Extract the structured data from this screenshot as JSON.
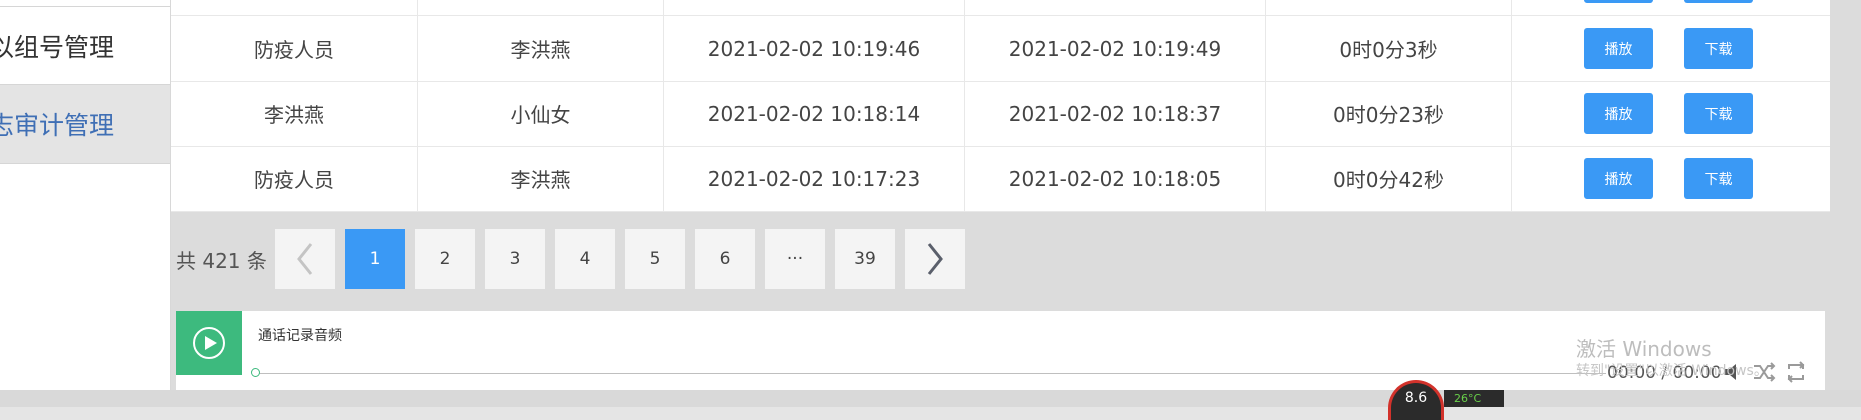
{
  "sidebar": {
    "items": [
      {
        "label": "以组号管理"
      },
      {
        "label": "志审计管理"
      }
    ]
  },
  "table": {
    "rows": [
      {
        "caller": "",
        "callee": "",
        "start": "",
        "end": "",
        "duration": ""
      },
      {
        "caller": "防疫人员",
        "callee": "李洪燕",
        "start": "2021-02-02 10:19:46",
        "end": "2021-02-02 10:19:49",
        "duration": "0时0分3秒"
      },
      {
        "caller": "李洪燕",
        "callee": "小仙女",
        "start": "2021-02-02 10:18:14",
        "end": "2021-02-02 10:18:37",
        "duration": "0时0分23秒"
      },
      {
        "caller": "防疫人员",
        "callee": "李洪燕",
        "start": "2021-02-02 10:17:23",
        "end": "2021-02-02 10:18:05",
        "duration": "0时0分42秒"
      }
    ],
    "play_label": "播放",
    "download_label": "下载"
  },
  "pagination": {
    "total": "共 421 条",
    "pages": [
      "1",
      "2",
      "3",
      "4",
      "5",
      "6",
      "···",
      "39"
    ],
    "active_page": "1"
  },
  "player": {
    "title": "通话记录音频",
    "time": "00:00 / 00:00"
  },
  "watermark": {
    "line1": "激活 Windows",
    "line2": "转到\"设置\"以激活 Windows。"
  },
  "taskbar": {
    "gauge": "8.6",
    "temperature": "26°C"
  },
  "colors": {
    "primary": "#3a99f5",
    "player_green": "#3dba7e",
    "sidebar_active_text": "#3f6fb5"
  }
}
